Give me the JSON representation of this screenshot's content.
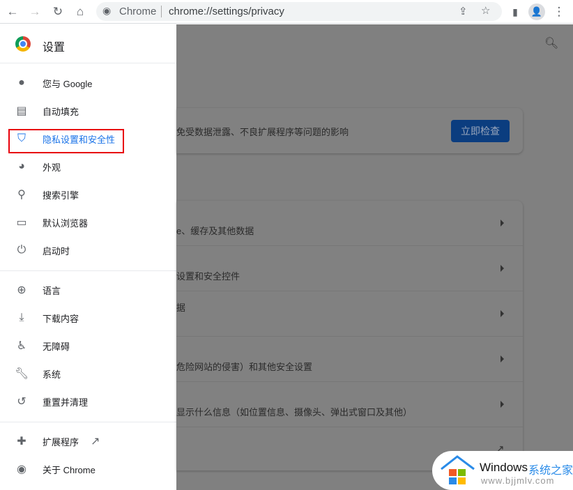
{
  "toolbar": {
    "site_name": "Chrome",
    "url": "chrome://settings/privacy",
    "icons": [
      "back-icon",
      "forward-icon",
      "reload-icon",
      "home-icon",
      "share-icon",
      "star-icon",
      "side-panel-icon",
      "profile-icon",
      "menu-icon"
    ]
  },
  "sidebar": {
    "title": "设置",
    "items": [
      {
        "label": "您与 Google",
        "icon": "person-icon"
      },
      {
        "label": "自动填充",
        "icon": "clipboard-icon"
      },
      {
        "label": "隐私设置和安全性",
        "icon": "shield-icon",
        "active": true
      },
      {
        "label": "外观",
        "icon": "palette-icon"
      },
      {
        "label": "搜索引擎",
        "icon": "search-icon"
      },
      {
        "label": "默认浏览器",
        "icon": "browser-icon"
      },
      {
        "label": "启动时",
        "icon": "power-icon"
      },
      {
        "label": "语言",
        "icon": "globe-icon"
      },
      {
        "label": "下载内容",
        "icon": "download-icon"
      },
      {
        "label": "无障碍",
        "icon": "accessibility-icon"
      },
      {
        "label": "系统",
        "icon": "wrench-icon"
      },
      {
        "label": "重置并清理",
        "icon": "restore-icon"
      },
      {
        "label": "扩展程序",
        "icon": "puzzle-icon"
      },
      {
        "label": "关于 Chrome",
        "icon": "chrome-icon"
      }
    ]
  },
  "main": {
    "safety_text": "免受数据泄露、不良扩展程序等问题的影响",
    "check_button": "立即检查",
    "rows": [
      "e、缓存及其他数据",
      "设置和安全控件",
      "据",
      "危险网站的侵害）和其他安全设置",
      "显示什么信息（如位置信息、摄像头、弹出式窗口及其他）"
    ]
  },
  "watermark": {
    "brand": "Windows",
    "brand_cn": "系统之家",
    "site": "www.bjjmlv.com"
  },
  "colors": {
    "accent": "#1a73e8",
    "highlight": "#e8000b",
    "overlay": "#808080"
  }
}
